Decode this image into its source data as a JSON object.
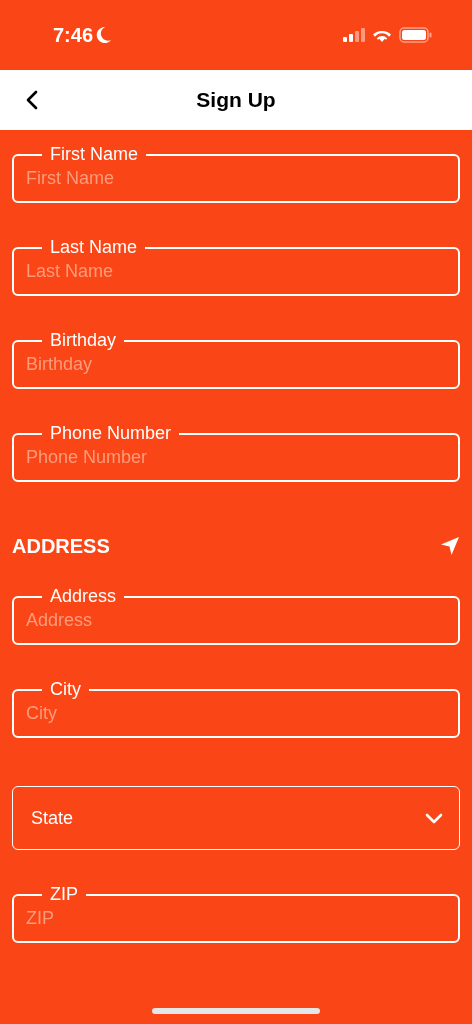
{
  "status_bar": {
    "time": "7:46"
  },
  "nav_bar": {
    "title": "Sign Up"
  },
  "personal_fields": [
    {
      "kind": "text",
      "label": "First Name",
      "placeholder": "First Name"
    },
    {
      "kind": "text",
      "label": "Last Name",
      "placeholder": "Last Name"
    },
    {
      "kind": "text",
      "label": "Birthday",
      "placeholder": "Birthday"
    },
    {
      "kind": "text",
      "label": "Phone Number",
      "placeholder": "Phone Number"
    }
  ],
  "address_section": {
    "title": "ADDRESS",
    "fields": [
      {
        "kind": "text",
        "label": "Address",
        "placeholder": "Address"
      },
      {
        "kind": "text",
        "label": "City",
        "placeholder": "City"
      },
      {
        "kind": "select",
        "label": "State"
      },
      {
        "kind": "text",
        "label": "ZIP",
        "placeholder": "ZIP"
      }
    ]
  }
}
